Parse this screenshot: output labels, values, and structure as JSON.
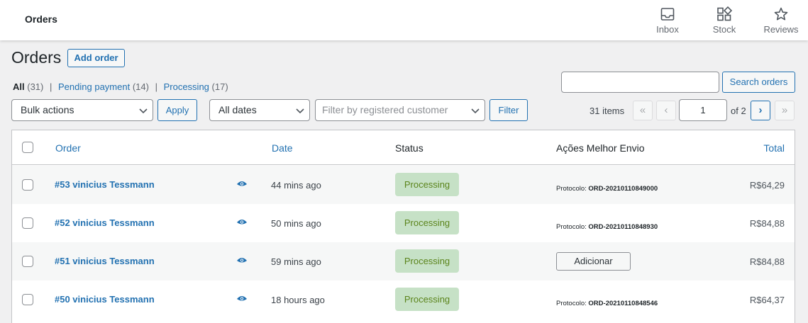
{
  "topbar": {
    "title": "Orders",
    "activity": [
      {
        "label": "Inbox",
        "icon": "inbox-icon"
      },
      {
        "label": "Stock",
        "icon": "stock-icon"
      },
      {
        "label": "Reviews",
        "icon": "star-icon"
      }
    ]
  },
  "page": {
    "heading": "Orders",
    "add_order_label": "Add order"
  },
  "views": {
    "all": {
      "label": "All",
      "count": "(31)"
    },
    "pending": {
      "label": "Pending payment",
      "count": "(14)"
    },
    "processing": {
      "label": "Processing",
      "count": "(17)"
    },
    "separator": "|"
  },
  "search": {
    "value": "",
    "button_label": "Search orders"
  },
  "filters": {
    "bulk_actions": "Bulk actions",
    "apply_label": "Apply",
    "dates": "All dates",
    "customer_placeholder": "Filter by registered customer",
    "filter_label": "Filter"
  },
  "pagination": {
    "items": "31 items",
    "first": "«",
    "prev": "‹",
    "current_page": "1",
    "of_total": "of 2",
    "next": "›",
    "last": "»"
  },
  "table": {
    "columns": {
      "order": "Order",
      "date": "Date",
      "status": "Status",
      "melhor_envio": "Ações Melhor Envio",
      "total": "Total"
    },
    "rows": [
      {
        "order": "#53 vinicius Tessmann",
        "date": "44 mins ago",
        "status": "Processing",
        "protocolo_label": "Protocolo:",
        "protocolo": "ORD-20210110849000",
        "action": "",
        "total": "R$64,29"
      },
      {
        "order": "#52 vinicius Tessmann",
        "date": "50 mins ago",
        "status": "Processing",
        "protocolo_label": "Protocolo:",
        "protocolo": "ORD-20210110848930",
        "action": "",
        "total": "R$84,88"
      },
      {
        "order": "#51 vinicius Tessmann",
        "date": "59 mins ago",
        "status": "Processing",
        "protocolo_label": "",
        "protocolo": "",
        "action": "Adicionar",
        "total": "R$84,88"
      },
      {
        "order": "#50 vinicius Tessmann",
        "date": "18 hours ago",
        "status": "Processing",
        "protocolo_label": "Protocolo:",
        "protocolo": "ORD-20210110848546",
        "action": "",
        "total": "R$64,37"
      }
    ]
  },
  "colors": {
    "link": "#2271b1",
    "status_processing_bg": "#c6e1c6",
    "status_processing_text": "#5b841b",
    "page_bg": "#f0f0f1"
  }
}
